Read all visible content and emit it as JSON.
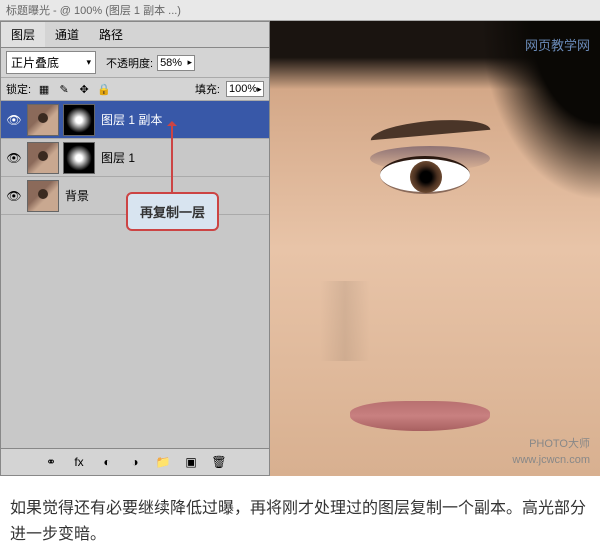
{
  "title_bar": "标题曝光 - @ 100% (图层 1 副本 ...)",
  "tabs": {
    "layers": "图层",
    "channels": "通道",
    "paths": "路径"
  },
  "blend": {
    "mode": "正片叠底",
    "opacity_label": "不透明度:",
    "opacity_value": "58%"
  },
  "lock": {
    "label": "锁定:",
    "fill_label": "填充:",
    "fill_value": "100%"
  },
  "layers": [
    {
      "name": "图层 1 副本",
      "selected": true,
      "has_mask": true
    },
    {
      "name": "图层 1",
      "selected": false,
      "has_mask": true
    },
    {
      "name": "背景",
      "selected": false,
      "has_mask": false
    }
  ],
  "callout": "再复制一层",
  "watermarks": {
    "top": "网页教学网",
    "bottom1": "PHOTO大师",
    "bottom2": "www.jcwcn.com"
  },
  "caption": "如果觉得还有必要继续降低过曝，再将刚才处理过的图层复制一个副本。高光部分进一步变暗。"
}
